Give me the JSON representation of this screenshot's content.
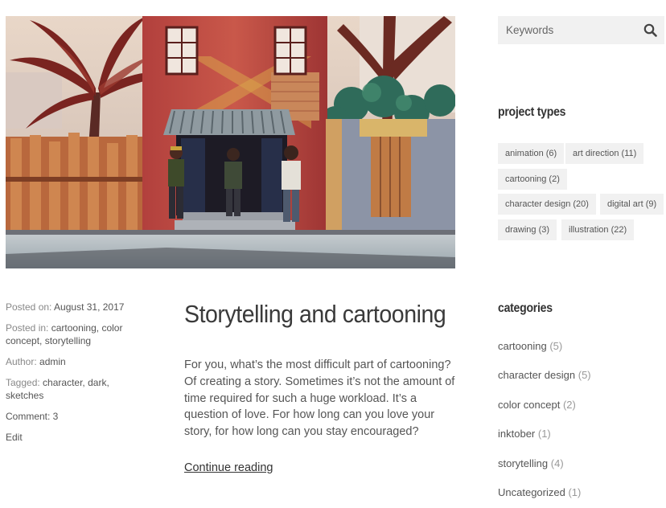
{
  "hero": {
    "alt": "Cartoon street scene with three characters in front of a red building"
  },
  "meta": {
    "posted_on_label": "Posted on:",
    "posted_on_date": "August 31, 2017",
    "posted_in_label": "Posted in:",
    "categories": [
      "cartooning",
      "color concept",
      "storytelling"
    ],
    "author_label": "Author:",
    "author": "admin",
    "tagged_label": "Tagged:",
    "tags": [
      "character",
      "dark",
      "sketches"
    ],
    "comments": "Comment: 3",
    "edit": "Edit"
  },
  "post": {
    "title": "Storytelling and cartooning",
    "excerpt": "For you, what’s the most difficult part of cartooning? Of creating a story. Sometimes it’s not the amount of time required for such a huge workload. It’s a question of love. For how long can you love your story, for how long can you stay encouraged?",
    "continue_label": "Continue reading"
  },
  "sidebar": {
    "search_placeholder": "Keywords",
    "project_types_title": "project types",
    "project_types": [
      "animation (6)",
      "art direction (11)",
      "cartooning (2)",
      "character design (20)",
      "digital art (9)",
      "drawing (3)",
      "illustration (22)"
    ],
    "categories_title": "categories",
    "categories": [
      {
        "name": "cartooning",
        "count": "(5)"
      },
      {
        "name": "character design",
        "count": "(5)"
      },
      {
        "name": "color concept",
        "count": "(2)"
      },
      {
        "name": "inktober",
        "count": "(1)"
      },
      {
        "name": "storytelling",
        "count": "(4)"
      },
      {
        "name": "Uncategorized",
        "count": "(1)"
      }
    ]
  }
}
